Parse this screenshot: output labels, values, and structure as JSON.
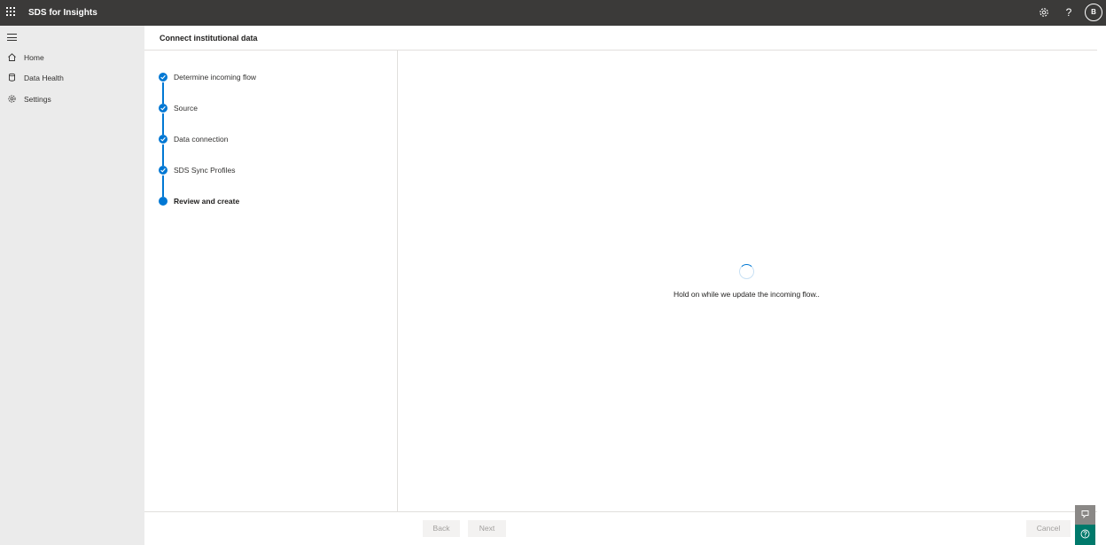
{
  "app": {
    "title": "SDS for Insights",
    "user_initial": "B",
    "help_glyph": "?",
    "icons": {
      "launcher": "waffle-icon",
      "settings": "gear-icon",
      "help": "question-icon"
    }
  },
  "sidebar": {
    "items": [
      {
        "label": "Home",
        "icon": "home-icon"
      },
      {
        "label": "Data Health",
        "icon": "database-icon"
      },
      {
        "label": "Settings",
        "icon": "gear-icon"
      }
    ]
  },
  "page": {
    "title": "Connect institutional data"
  },
  "steps": [
    {
      "label": "Determine incoming flow",
      "state": "completed"
    },
    {
      "label": "Source",
      "state": "completed"
    },
    {
      "label": "Data connection",
      "state": "completed"
    },
    {
      "label": "SDS Sync Profiles",
      "state": "completed"
    },
    {
      "label": "Review and create",
      "state": "current"
    }
  ],
  "content": {
    "loading_message": "Hold on while we update the incoming flow.."
  },
  "footer": {
    "back_label": "Back",
    "next_label": "Next",
    "cancel_label": "Cancel"
  },
  "colors": {
    "topbar": "#3b3a39",
    "sidebar": "#ebebeb",
    "accent": "#0078d4",
    "help_fab": "#00796b"
  }
}
